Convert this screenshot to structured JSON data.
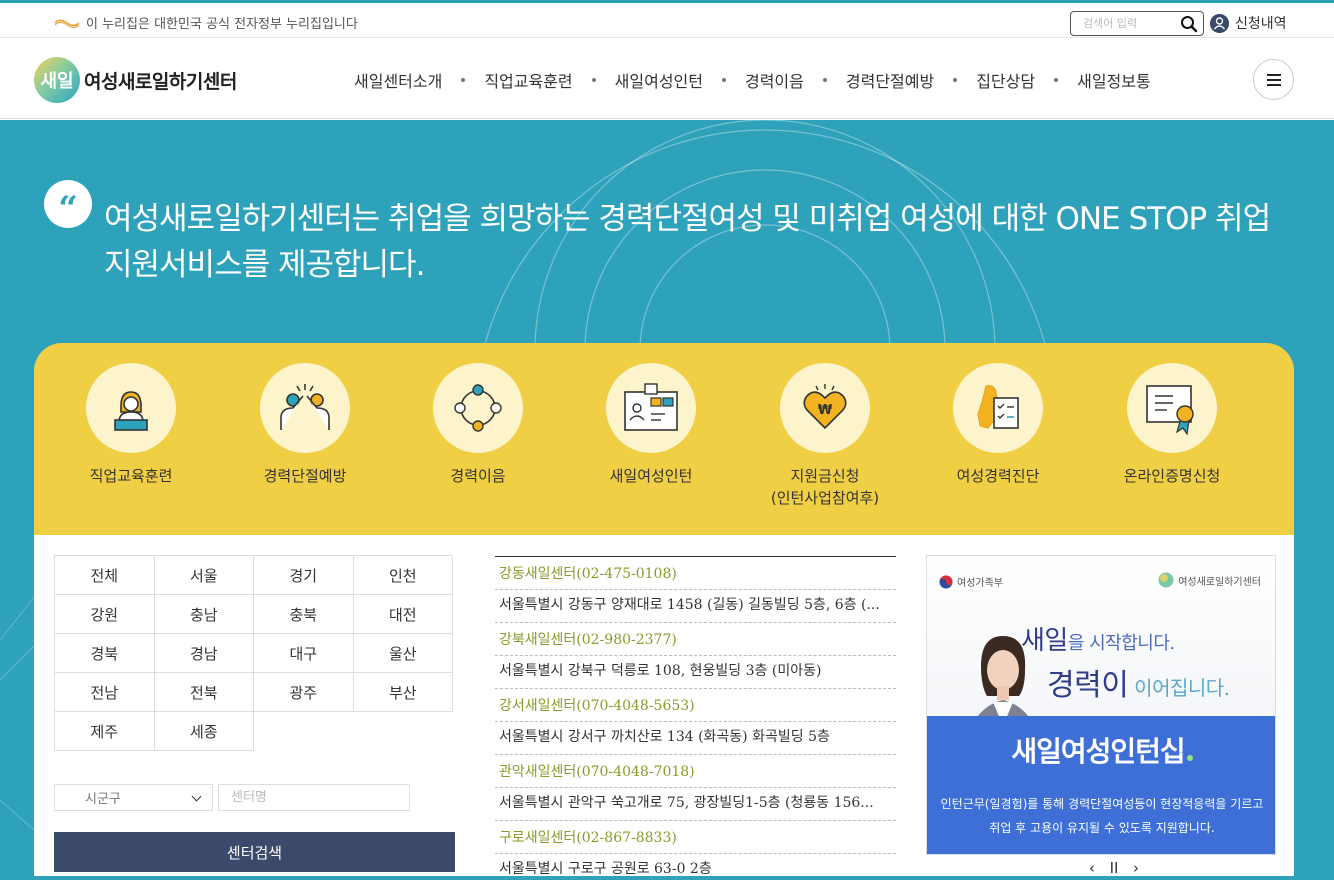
{
  "topbar": {
    "gov_notice": "이 누리집은 대한민국 공식 전자정부 누리집입니다",
    "search_placeholder": "검색어 입력",
    "apply_history": "신청내역"
  },
  "header": {
    "logo_mark": "새일",
    "logo_text": "여성새로일하기센터",
    "nav": [
      "새일센터소개",
      "직업교육훈련",
      "새일여성인턴",
      "경력이음",
      "경력단절예방",
      "집단상담",
      "새일정보통"
    ]
  },
  "hero": {
    "quote_mark": "“",
    "text": "여성새로일하기센터는 취업을 희망하는 경력단절여성 및 미취업 여성에 대한 ONE STOP 취업지원서비스를 제공합니다."
  },
  "quick": [
    {
      "label": "직업교육훈련",
      "icon": "instructor-icon"
    },
    {
      "label": "경력단절예방",
      "icon": "high-five-icon"
    },
    {
      "label": "경력이음",
      "icon": "people-circle-icon"
    },
    {
      "label": "새일여성인턴",
      "icon": "id-card-icon"
    },
    {
      "label": "지원금신청\n(인턴사업참여후)",
      "label1": "지원금신청",
      "label2": "(인턴사업참여후)",
      "icon": "heart-money-icon"
    },
    {
      "label": "여성경력진단",
      "icon": "korea-checklist-icon"
    },
    {
      "label": "온라인증명신청",
      "icon": "certificate-icon"
    }
  ],
  "regions": [
    "전체",
    "서울",
    "경기",
    "인천",
    "강원",
    "충남",
    "충북",
    "대전",
    "경북",
    "경남",
    "대구",
    "울산",
    "전남",
    "전북",
    "광주",
    "부산",
    "제주",
    "세종"
  ],
  "filter": {
    "district_select": "시군구",
    "center_placeholder": "센터명",
    "search_button": "센터검색"
  },
  "centers": [
    {
      "name": "강동새일센터(02-475-0108)",
      "address": "서울특별시 강동구 양재대로 1458 (길동) 길동빌딩 5층, 6층 (..."
    },
    {
      "name": "강북새일센터(02-980-2377)",
      "address": "서울특별시 강북구 덕릉로 108, 현웅빌딩 3층 (미아동)"
    },
    {
      "name": "강서새일센터(070-4048-5653)",
      "address": "서울특별시 강서구 까치산로 134 (화곡동) 화곡빌딩 5층"
    },
    {
      "name": "관악새일센터(070-4048-7018)",
      "address": "서울특별시 관악구 쑥고개로 75, 광장빌딩1-5층 (청룡동 156..."
    },
    {
      "name": "구로새일센터(02-867-8833)",
      "address": "서울특별시 구로구 공원로 63-0 2층"
    }
  ],
  "banner": {
    "ministry": "여성가족부",
    "center": "여성새로일하기센터",
    "headline1_main": "새일",
    "headline1_sub": "을 시작합니다.",
    "headline2_main": "경력이",
    "headline2_sub": " 이어집니다.",
    "title": "새일여성인턴십",
    "desc1": "인턴근무(일경험)를 통해 경력단절여성등이 현장적응력을 기르고",
    "desc2": "취업 후 고용이 유지될 수 있도록 지원합니다.",
    "prev": "‹",
    "pause": "II",
    "next": "›"
  },
  "colors": {
    "hero_bg": "#2fa2bb",
    "quick_bg": "#f0cf44",
    "button_bg": "#3b4a6b",
    "center_name": "#8a9a2a",
    "banner_blue": "#3d6fd7"
  }
}
